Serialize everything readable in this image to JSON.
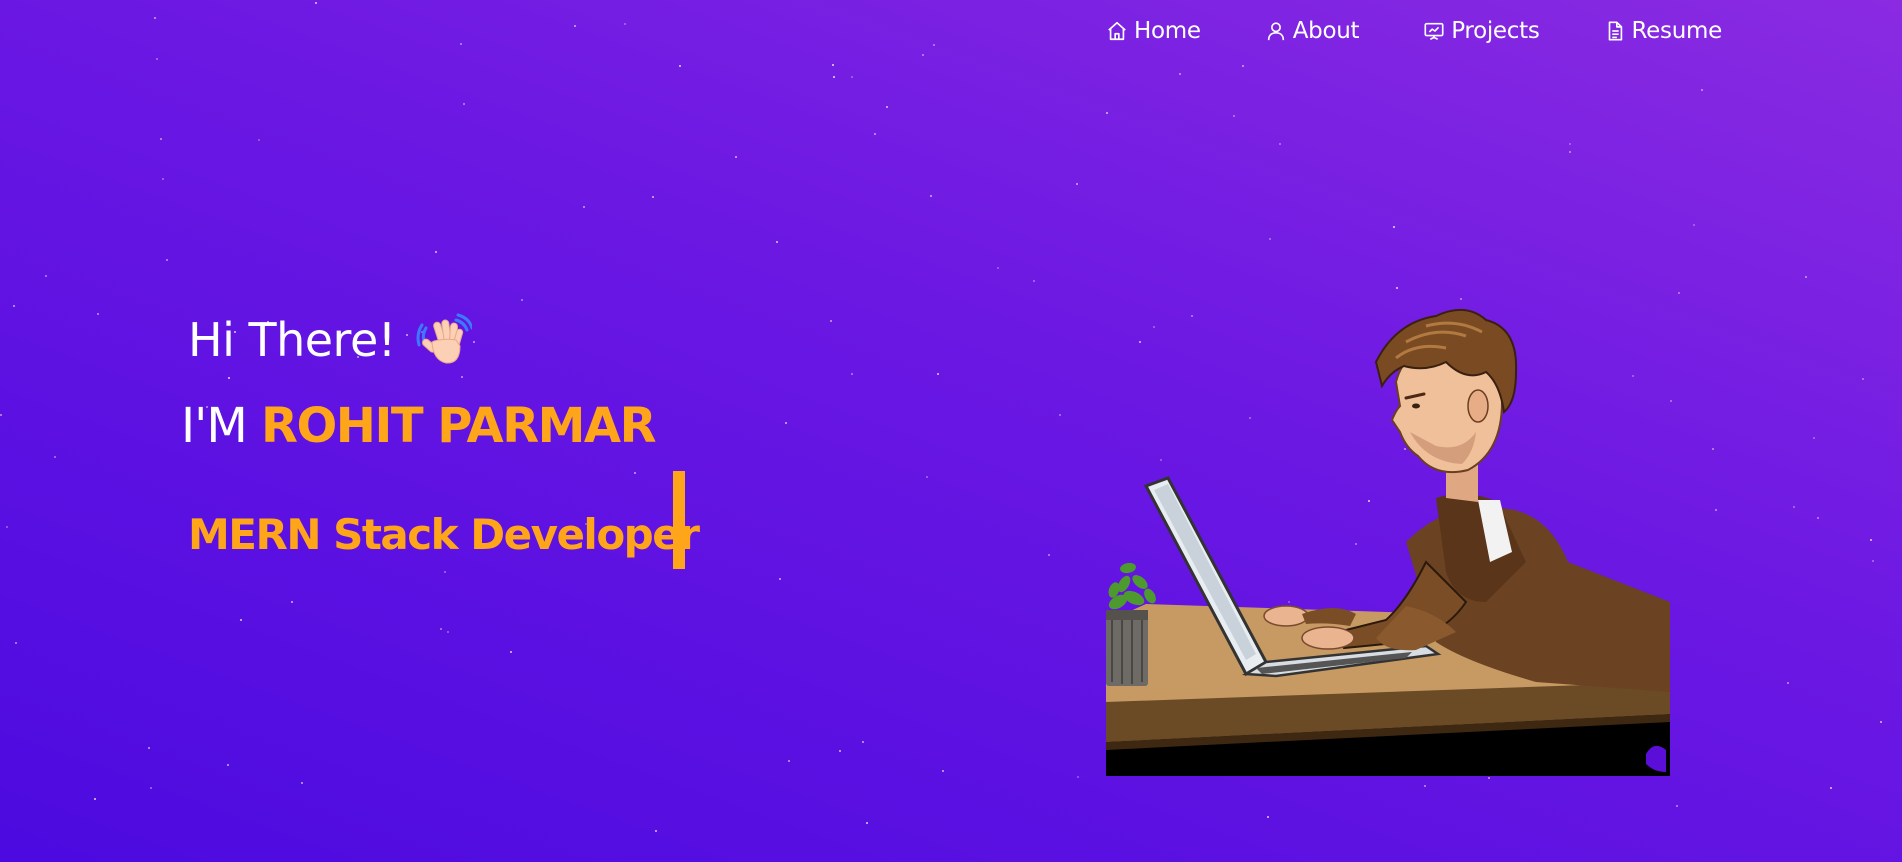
{
  "nav": {
    "items": [
      {
        "label": "Home",
        "icon": "home-icon"
      },
      {
        "label": "About",
        "icon": "user-icon"
      },
      {
        "label": "Projects",
        "icon": "presentation-icon"
      },
      {
        "label": "Resume",
        "icon": "document-icon"
      }
    ]
  },
  "hero": {
    "greeting": "Hi There!",
    "greeting_icon": "waving-hand-icon",
    "intro_prefix": "I'M",
    "name": "ROHIT PARMAR",
    "role": "MERN Stack Developer"
  },
  "illustration": {
    "subject": "developer-at-laptop-illustration"
  },
  "colors": {
    "background_top": "#8a2be2",
    "background_bottom": "#4c0ae0",
    "accent": "#ffa51a",
    "text": "#ffffff"
  }
}
